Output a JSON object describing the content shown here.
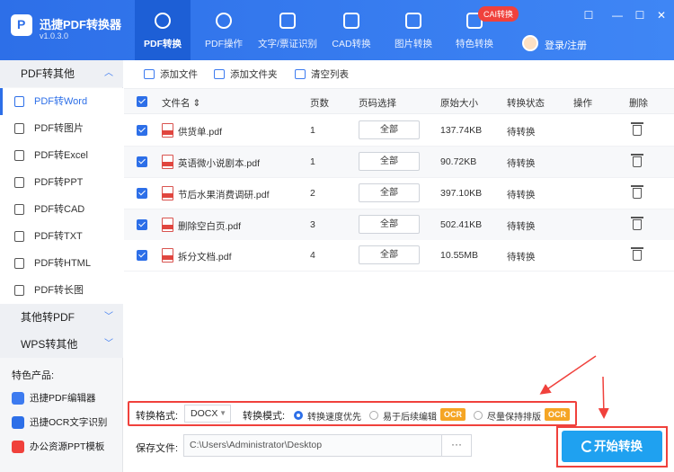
{
  "app": {
    "name": "迅捷PDF转换器",
    "version": "v1.0.3.0"
  },
  "tabs": [
    {
      "label": "PDF转换",
      "icon": "pdf-convert-icon"
    },
    {
      "label": "PDF操作",
      "icon": "pdf-operate-icon"
    },
    {
      "label": "文字/票证识别",
      "icon": "text-recognize-icon"
    },
    {
      "label": "CAD转换",
      "icon": "cad-icon"
    },
    {
      "label": "图片转换",
      "icon": "image-icon"
    },
    {
      "label": "特色转换",
      "icon": "star-icon"
    }
  ],
  "cad_badge": "CAI转换",
  "login_label": "登录/注册",
  "window_controls": [
    "☐",
    "—",
    "☐",
    "✕"
  ],
  "sidebar": {
    "group1": "PDF转其他",
    "items": [
      {
        "label": "PDF转Word"
      },
      {
        "label": "PDF转图片"
      },
      {
        "label": "PDF转Excel"
      },
      {
        "label": "PDF转PPT"
      },
      {
        "label": "PDF转CAD"
      },
      {
        "label": "PDF转TXT"
      },
      {
        "label": "PDF转HTML"
      },
      {
        "label": "PDF转长图"
      }
    ],
    "group2": "其他转PDF",
    "group3": "WPS转其他",
    "features_title": "特色产品:",
    "features": [
      {
        "label": "迅捷PDF编辑器",
        "color": "#3d7bf0"
      },
      {
        "label": "迅捷OCR文字识别",
        "color": "#2d6fe8"
      },
      {
        "label": "办公资源PPT模板",
        "color": "#f0413c"
      }
    ]
  },
  "toolbar": {
    "add_file": "添加文件",
    "add_folder": "添加文件夹",
    "clear_list": "清空列表"
  },
  "table": {
    "headers": {
      "name": "文件名 ⇕",
      "pages": "页数",
      "page_select": "页码选择",
      "size": "原始大小",
      "status": "转换状态",
      "action": "操作",
      "delete": "删除"
    },
    "rows": [
      {
        "name": "供货单.pdf",
        "pages": "1",
        "page_select": "全部",
        "size": "137.74KB",
        "status": "待转换"
      },
      {
        "name": "英语微小说剧本.pdf",
        "pages": "1",
        "page_select": "全部",
        "size": "90.72KB",
        "status": "待转换"
      },
      {
        "name": "节后水果消费调研.pdf",
        "pages": "2",
        "page_select": "全部",
        "size": "397.10KB",
        "status": "待转换"
      },
      {
        "name": "删除空白页.pdf",
        "pages": "3",
        "page_select": "全部",
        "size": "502.41KB",
        "status": "待转换"
      },
      {
        "name": "拆分文档.pdf",
        "pages": "4",
        "page_select": "全部",
        "size": "10.55MB",
        "status": "待转换"
      }
    ]
  },
  "options": {
    "format_label": "转换格式:",
    "format_value": "DOCX",
    "mode_label": "转换模式:",
    "modes": [
      {
        "label": "转换速度优先",
        "selected": true
      },
      {
        "label": "易于后续编辑",
        "ocr": "OCR"
      },
      {
        "label": "尽量保持排版",
        "ocr": "OCR"
      }
    ]
  },
  "save": {
    "label": "保存文件:",
    "path": "C:\\Users\\Administrator\\Desktop",
    "browse": "···"
  },
  "start_button": "开始转换",
  "colors": {
    "primary": "#2d6fe8",
    "highlight_red": "#f0413c",
    "start_button": "#1fa1f0",
    "ocr_badge": "#f5a524"
  }
}
